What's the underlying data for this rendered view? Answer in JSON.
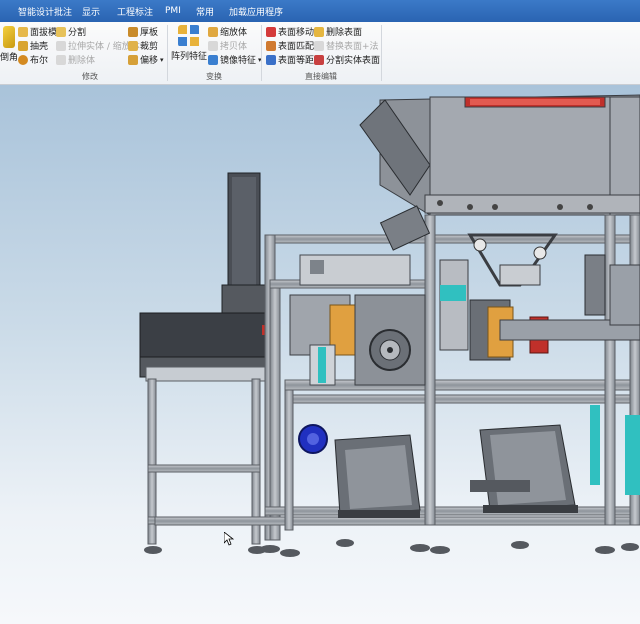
{
  "menu": {
    "items": [
      "智能设计批注",
      "显示",
      "工程标注",
      "PMI",
      "常用",
      "加载应用程序"
    ]
  },
  "ribbon": {
    "partial_left_label": "倒角",
    "groups": {
      "modify": {
        "label": "修改",
        "buttons": {
          "draft": "面拔模",
          "shell": "抽壳",
          "boolean": "布尔",
          "split": "分割",
          "stretch": "拉伸实体 / 缩放体",
          "delete": "删除体",
          "thicken": "厚板",
          "trim": "裁剪",
          "offset": "偏移"
        }
      },
      "transform": {
        "label": "变换",
        "buttons": {
          "pattern": "阵列特征",
          "scale": "缩放体",
          "copy": "拷贝体",
          "mirror": "镜像特征"
        }
      },
      "direct_edit": {
        "label": "直接编辑",
        "buttons": {
          "move_face": "表面移动",
          "match_face": "表面匹配",
          "equal_dist": "表面等距",
          "delete_face": "删除表面",
          "replace_face": "替换表面+法",
          "split_solid": "分割实体表面"
        }
      }
    }
  },
  "colors": {
    "menubar": "#2a64b2",
    "frame_gray": "#9aa0a8",
    "frame_dark": "#3a3d42",
    "accent_orange": "#e0a040",
    "accent_red": "#c0302a",
    "accent_blue": "#2030c0",
    "accent_cyan": "#30c0c0"
  },
  "icons": {
    "cursor": "mouse-pointer-icon"
  }
}
